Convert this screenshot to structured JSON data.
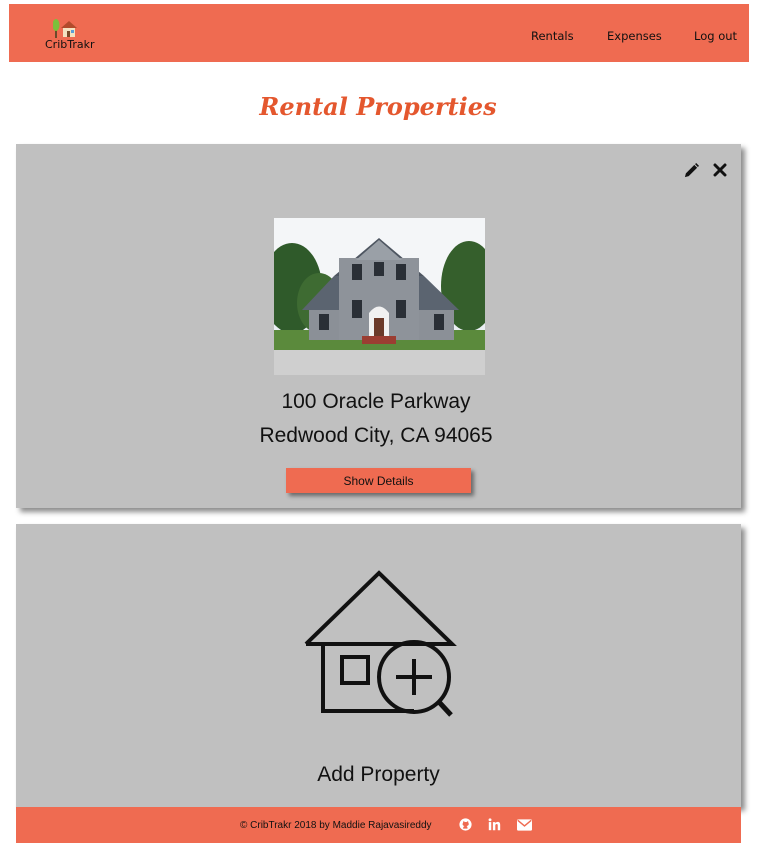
{
  "navbar": {
    "logo_icon": "house-with-tree-icon",
    "brand": "CribTrakr",
    "links": [
      "Rentals",
      "Expenses",
      "Log out"
    ]
  },
  "page": {
    "title": "Rental Properties"
  },
  "properties": [
    {
      "photo": "house-photo",
      "address_line1": "100 Oracle Parkway",
      "address_line2": "Redwood City, CA 94065",
      "button": "Show Details",
      "actions": [
        "pencil-icon",
        "close-icon"
      ]
    }
  ],
  "add_card": {
    "icon": "house-add-icon",
    "label": "Add Property"
  },
  "footer": {
    "text": "© CribTrakr 2018 by Maddie Rajavasireddy",
    "icons": [
      "github-icon",
      "linkedin-icon",
      "envelope-icon"
    ]
  },
  "colors": {
    "accent": "#ef6b51",
    "title": "#e4572e",
    "card": "#c0c0c0"
  }
}
